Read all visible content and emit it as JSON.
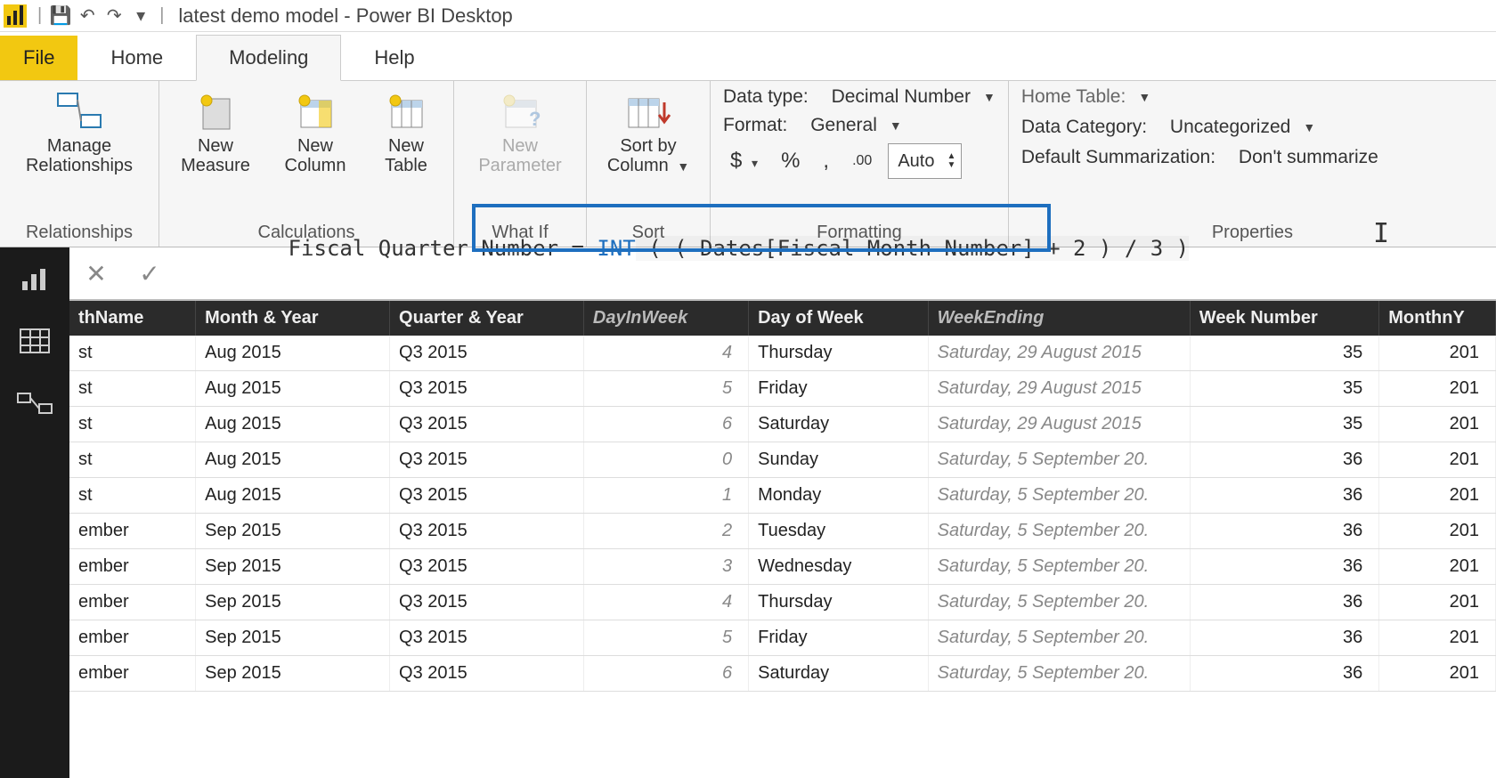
{
  "title": "latest demo model - Power BI Desktop",
  "qat": {
    "save": "💾",
    "undo": "↶",
    "redo": "↷",
    "more": "▾"
  },
  "tabs": {
    "file": "File",
    "home": "Home",
    "modeling": "Modeling",
    "help": "Help"
  },
  "ribbon": {
    "relationships": {
      "manage": "Manage\nRelationships",
      "caption": "Relationships"
    },
    "calculations": {
      "new_measure": "New\nMeasure",
      "new_column": "New\nColumn",
      "new_table": "New\nTable",
      "caption": "Calculations"
    },
    "whatif": {
      "new_param": "New\nParameter",
      "caption": "What If"
    },
    "sort": {
      "sortby": "Sort by\nColumn",
      "caption": "Sort"
    },
    "formatting": {
      "datatype_label": "Data type:",
      "datatype_value": "Decimal Number",
      "format_label": "Format:",
      "format_value": "General",
      "currency": "$",
      "percent": "%",
      "thousand": ",",
      "decimal_icon": ".00",
      "decimals": "Auto",
      "caption": "Formatting"
    },
    "properties": {
      "home_table": "Home Table:",
      "data_category_label": "Data Category:",
      "data_category_value": "Uncategorized",
      "default_sum_label": "Default Summarization:",
      "default_sum_value": "Don't summarize",
      "caption": "Properties"
    }
  },
  "formula": {
    "cancel": "✕",
    "commit": "✓",
    "left_text": "Fiscal Quarter Number =",
    "keyword": "INT",
    "rest": " ( ( Dates[Fiscal Month Number] + 2 ) / 3 )"
  },
  "grid": {
    "columns": [
      {
        "label": "thName",
        "calc": false,
        "align": "left"
      },
      {
        "label": "Month & Year",
        "calc": false,
        "align": "left"
      },
      {
        "label": "Quarter & Year",
        "calc": false,
        "align": "left"
      },
      {
        "label": "DayInWeek",
        "calc": true,
        "align": "right"
      },
      {
        "label": "Day of Week",
        "calc": false,
        "align": "left"
      },
      {
        "label": "WeekEnding",
        "calc": true,
        "align": "left"
      },
      {
        "label": "Week Number",
        "calc": false,
        "align": "right"
      },
      {
        "label": "MonthnY",
        "calc": false,
        "align": "right"
      }
    ],
    "rows": [
      [
        "st",
        "Aug 2015",
        "Q3 2015",
        "4",
        "Thursday",
        "Saturday, 29 August 2015",
        "35",
        "201"
      ],
      [
        "st",
        "Aug 2015",
        "Q3 2015",
        "5",
        "Friday",
        "Saturday, 29 August 2015",
        "35",
        "201"
      ],
      [
        "st",
        "Aug 2015",
        "Q3 2015",
        "6",
        "Saturday",
        "Saturday, 29 August 2015",
        "35",
        "201"
      ],
      [
        "st",
        "Aug 2015",
        "Q3 2015",
        "0",
        "Sunday",
        "Saturday, 5 September 20.",
        "36",
        "201"
      ],
      [
        "st",
        "Aug 2015",
        "Q3 2015",
        "1",
        "Monday",
        "Saturday, 5 September 20.",
        "36",
        "201"
      ],
      [
        "ember",
        "Sep 2015",
        "Q3 2015",
        "2",
        "Tuesday",
        "Saturday, 5 September 20.",
        "36",
        "201"
      ],
      [
        "ember",
        "Sep 2015",
        "Q3 2015",
        "3",
        "Wednesday",
        "Saturday, 5 September 20.",
        "36",
        "201"
      ],
      [
        "ember",
        "Sep 2015",
        "Q3 2015",
        "4",
        "Thursday",
        "Saturday, 5 September 20.",
        "36",
        "201"
      ],
      [
        "ember",
        "Sep 2015",
        "Q3 2015",
        "5",
        "Friday",
        "Saturday, 5 September 20.",
        "36",
        "201"
      ],
      [
        "ember",
        "Sep 2015",
        "Q3 2015",
        "6",
        "Saturday",
        "Saturday, 5 September 20.",
        "36",
        "201"
      ]
    ]
  }
}
